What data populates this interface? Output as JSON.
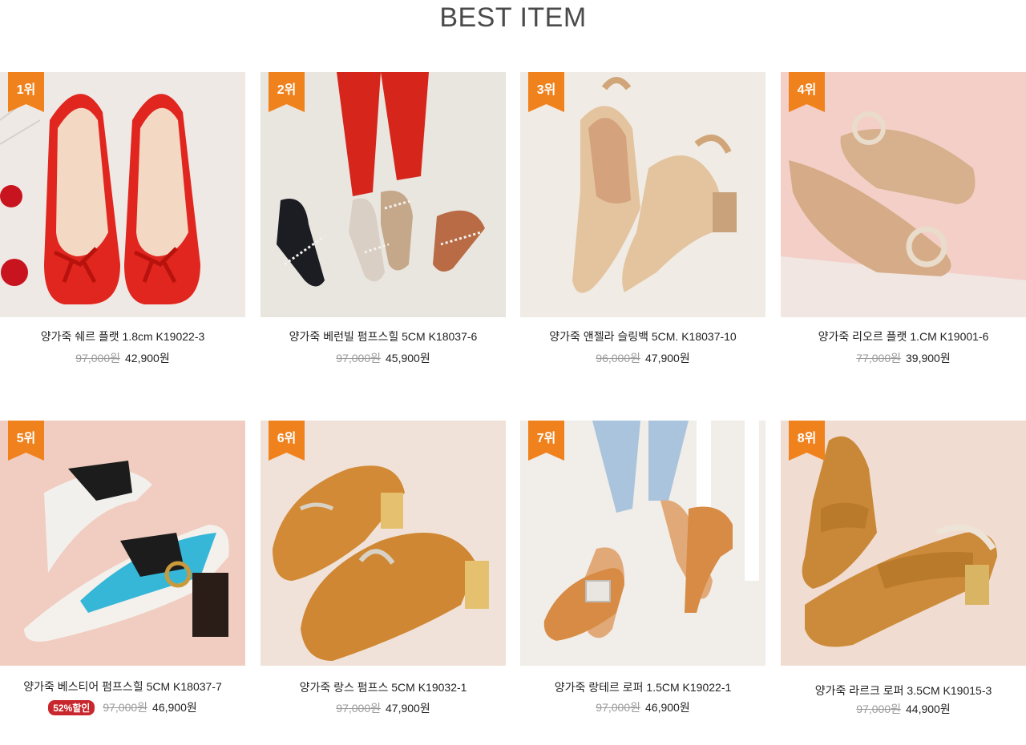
{
  "section_title": "BEST ITEM",
  "colors": {
    "badge": "#f0821e",
    "discount_badge": "#c8282d"
  },
  "products": [
    {
      "rank": "1위",
      "name": "양가죽 쉐르 플랫 1.8cm K19022-3",
      "original_price": "97,000원",
      "sale_price": "42,900원",
      "discount": ""
    },
    {
      "rank": "2위",
      "name": "양가죽 베런빌 펌프스힐 5CM K18037-6",
      "original_price": "97,000원",
      "sale_price": "45,900원",
      "discount": ""
    },
    {
      "rank": "3위",
      "name": "양가죽 앤젤라 슬링백 5CM. K18037-10",
      "original_price": "96,000원",
      "sale_price": "47,900원",
      "discount": ""
    },
    {
      "rank": "4위",
      "name": "양가죽 리오르 플랫 1.CM K19001-6",
      "original_price": "77,000원",
      "sale_price": "39,900원",
      "discount": ""
    },
    {
      "rank": "5위",
      "name": "양가죽 베스티어 펌프스힐 5CM K18037-7",
      "original_price": "97,000원",
      "sale_price": "46,900원",
      "discount": "52%할인"
    },
    {
      "rank": "6위",
      "name": "양가죽 랑스 펌프스 5CM K19032-1",
      "original_price": "97,000원",
      "sale_price": "47,900원",
      "discount": ""
    },
    {
      "rank": "7위",
      "name": "양가죽 랑테르 로퍼 1.5CM K19022-1",
      "original_price": "97,000원",
      "sale_price": "46,900원",
      "discount": ""
    },
    {
      "rank": "8위",
      "name": "양가죽 라르크 로퍼 3.5CM K19015-3",
      "original_price": "97,000원",
      "sale_price": "44,900원",
      "discount": ""
    }
  ]
}
